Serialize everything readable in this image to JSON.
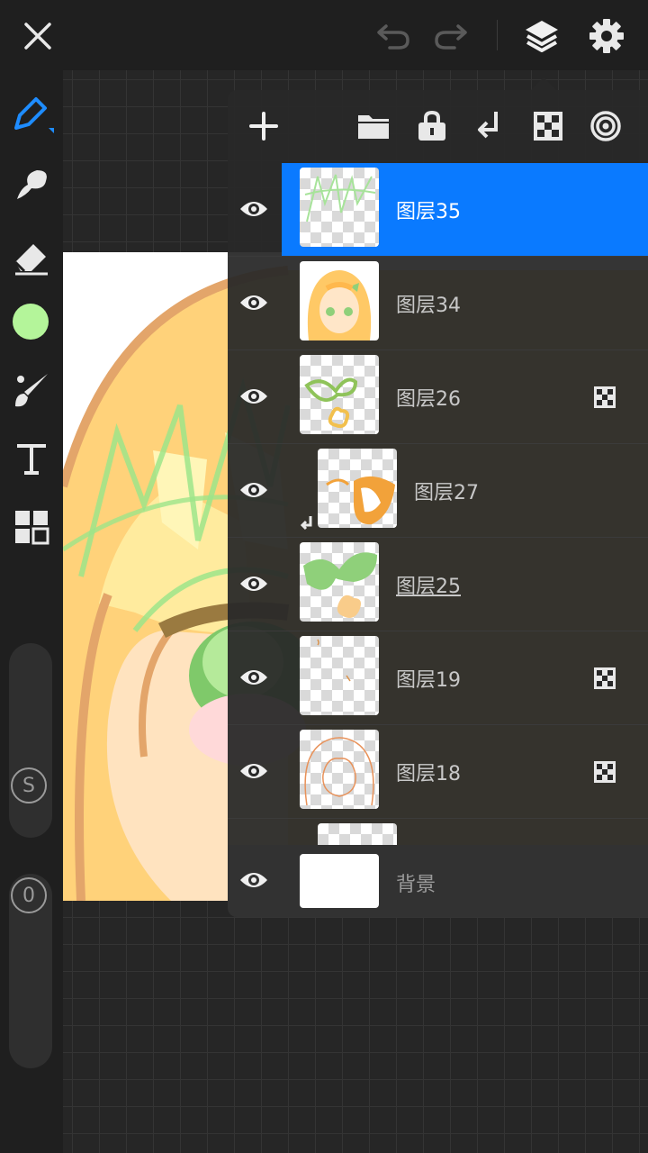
{
  "topbar": {
    "close_icon": "close-icon",
    "undo_icon": "undo-icon",
    "redo_icon": "redo-icon",
    "layers_icon": "layers-icon",
    "settings_icon": "gear-icon"
  },
  "toolbar": {
    "tools": [
      "pen-icon",
      "smudge-icon",
      "eraser-icon",
      "color-swatch",
      "brush-icon",
      "text-icon",
      "grid-icon"
    ],
    "current_color": "#b4f59a",
    "size_slider_label": "S",
    "opacity_slider_label": "0"
  },
  "layers_panel": {
    "actions": [
      "add-icon",
      "folder-icon",
      "lock-icon",
      "merge-down-icon",
      "checker-icon",
      "reference-icon"
    ],
    "layers": [
      {
        "name": "图层35",
        "selected": true,
        "alpha_lock": false,
        "clipped": false
      },
      {
        "name": "图层34",
        "selected": false,
        "alpha_lock": false,
        "clipped": false
      },
      {
        "name": "图层26",
        "selected": false,
        "alpha_lock": true,
        "clipped": false
      },
      {
        "name": "图层27",
        "selected": false,
        "alpha_lock": false,
        "clipped": true
      },
      {
        "name": "图层25",
        "selected": false,
        "alpha_lock": false,
        "clipped": false
      },
      {
        "name": "图层19",
        "selected": false,
        "alpha_lock": true,
        "clipped": false
      },
      {
        "name": "图层18",
        "selected": false,
        "alpha_lock": true,
        "clipped": false
      }
    ],
    "background_layer": {
      "name": "背景"
    }
  },
  "colors": {
    "accent": "#0a7aff",
    "panel": "#282828",
    "toolbar": "#1f1f1f"
  }
}
